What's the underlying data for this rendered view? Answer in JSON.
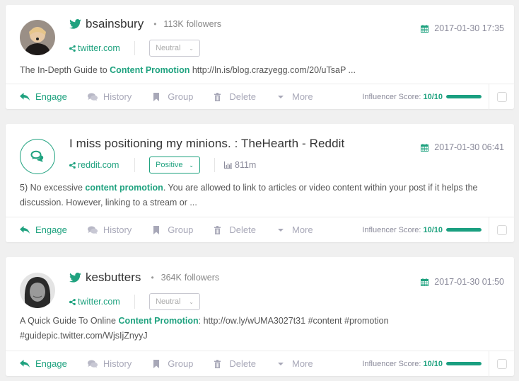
{
  "colors": {
    "accent": "#1fa27f",
    "muted": "#a8a8b8",
    "background": "#f0f0f0"
  },
  "actions": {
    "engage": "Engage",
    "history": "History",
    "group": "Group",
    "delete": "Delete",
    "more": "More"
  },
  "score_label": "Influencer Score:",
  "mentions": [
    {
      "platform": "twitter",
      "avatar_icon": "user-photo",
      "author": "bsainsbury",
      "followers_count": "113K",
      "followers_label": "followers",
      "source": "twitter.com",
      "sentiment": "Neutral",
      "date": "2017-01-30 17:35",
      "text_before": "The In-Depth Guide to ",
      "text_highlight": "Content Promotion",
      "text_after": " http://ln.is/blog.crazyegg.com/20/uTsaP ...",
      "score_text": "10/10",
      "score_fraction": 1.0
    },
    {
      "platform": "reddit",
      "avatar_icon": "comments-icon",
      "title": "I miss positioning my minions. : TheHearth - Reddit",
      "source": "reddit.com",
      "sentiment": "Positive",
      "reach": "811m",
      "date": "2017-01-30 06:41",
      "text_before": "5) No excessive ",
      "text_highlight": "content promotion",
      "text_after": ". You are allowed to link to articles or video content within your post if it helps the discussion. However, linking to a stream or  ...",
      "score_text": "10/10",
      "score_fraction": 1.0
    },
    {
      "platform": "twitter",
      "avatar_icon": "user-photo",
      "author": "kesbutters",
      "followers_count": "364K",
      "followers_label": "followers",
      "source": "twitter.com",
      "sentiment": "Neutral",
      "date": "2017-01-30 01:50",
      "text_before": "A Quick Guide To Online ",
      "text_highlight": "Content Promotion",
      "text_after": ": http://ow.ly/wUMA3027t31 #content #promotion #guidepic.twitter.com/WjsIjZnyyJ",
      "score_text": "10/10",
      "score_fraction": 1.0
    }
  ]
}
